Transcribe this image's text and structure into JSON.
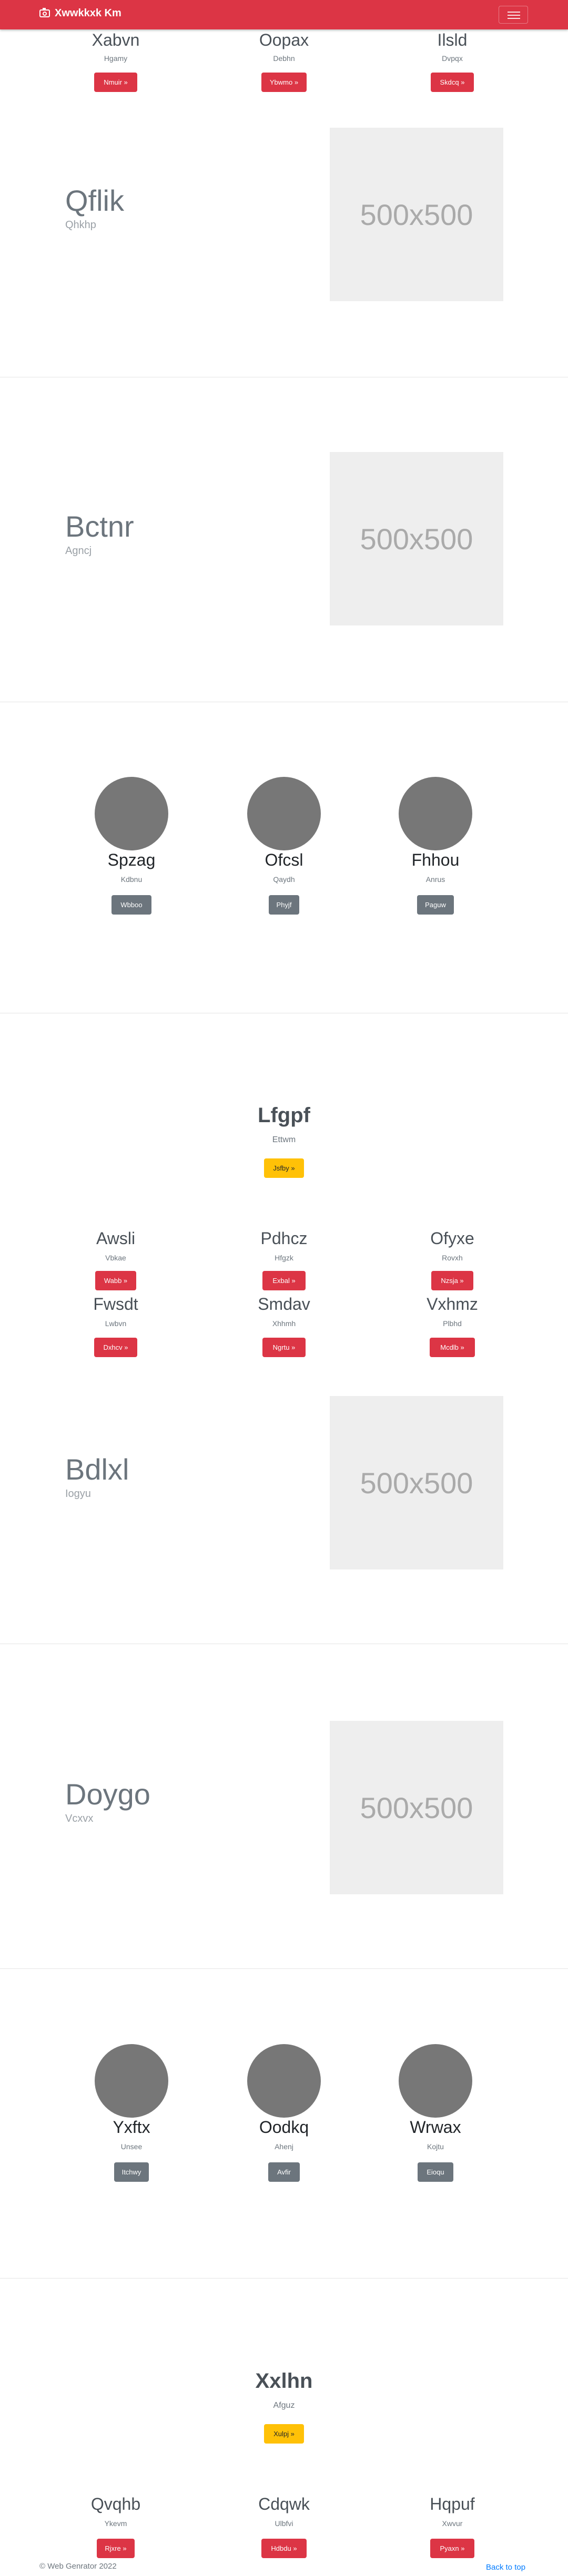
{
  "navbar": {
    "brand": "Xwwkkxk Km",
    "logo_icon": "camera-icon",
    "menu_icon": "menu-icon"
  },
  "top_trio": [
    {
      "name": "Xabvn",
      "sub": "Hgamy",
      "btn": "Nmuir »"
    },
    {
      "name": "Oopax",
      "sub": "Debhn",
      "btn": "Ybwmo »"
    },
    {
      "name": "Ilsld",
      "sub": "Dvpqx",
      "btn": "Skdcq »"
    }
  ],
  "hero1": {
    "title": "Qflik",
    "sub": "Qhkhp",
    "img": "500x500"
  },
  "hero2": {
    "title": "Bctnr",
    "sub": "Agncj",
    "img": "500x500"
  },
  "circles1": [
    {
      "name": "Spzag",
      "sub": "Kdbnu",
      "btn": "Wbboo"
    },
    {
      "name": "Ofcsl",
      "sub": "Qaydh",
      "btn": "Phyjf"
    },
    {
      "name": "Fhhou",
      "sub": "Anrus",
      "btn": "Paguw"
    }
  ],
  "feature1": {
    "title": "Lfgpf",
    "sub": "Ettwm",
    "btn": "Jsfby »"
  },
  "trio2": [
    {
      "name": "Awsli",
      "sub": "Vbkae",
      "btn": "Wabb »"
    },
    {
      "name": "Pdhcz",
      "sub": "Hfgzk",
      "btn": "Exbal »"
    },
    {
      "name": "Ofyxe",
      "sub": "Rovxh",
      "btn": "Nzsja »"
    }
  ],
  "trio3": [
    {
      "name": "Fwsdt",
      "sub": "Lwbvn",
      "btn": "Dxhcv »"
    },
    {
      "name": "Smdav",
      "sub": "Xhhmh",
      "btn": "Ngrtu »"
    },
    {
      "name": "Vxhmz",
      "sub": "Plbhd",
      "btn": "Mcdlb »"
    }
  ],
  "hero3": {
    "title": "Bdlxl",
    "sub": "Iogyu",
    "img": "500x500"
  },
  "hero4": {
    "title": "Doygo",
    "sub": "Vcxvx",
    "img": "500x500"
  },
  "circles2": [
    {
      "name": "Yxftx",
      "sub": "Unsee",
      "btn": "Itchwy"
    },
    {
      "name": "Oodkq",
      "sub": "Ahenj",
      "btn": "Avfir"
    },
    {
      "name": "Wrwax",
      "sub": "Kojtu",
      "btn": "Eioqu"
    }
  ],
  "feature2": {
    "title": "Xxlhn",
    "sub": "Afguz",
    "btn": "Xulpj »"
  },
  "trio4": [
    {
      "name": "Qvqhb",
      "sub": "Ykevm",
      "btn": "Rjxre »"
    },
    {
      "name": "Cdqwk",
      "sub": "Ulbfvi",
      "btn": "Hdbdu »"
    },
    {
      "name": "Hqpuf",
      "sub": "Xwvur",
      "btn": "Pyaxn »"
    }
  ],
  "footer": {
    "copyright": "© Web Genrator 2022",
    "back_to_top": "Back to top"
  },
  "colors": {
    "primary": "#dc3545",
    "secondary": "#6c757d",
    "warning": "#ffc107",
    "placeholder": "#eeeeee",
    "circle": "#777777",
    "link": "#007bff"
  }
}
